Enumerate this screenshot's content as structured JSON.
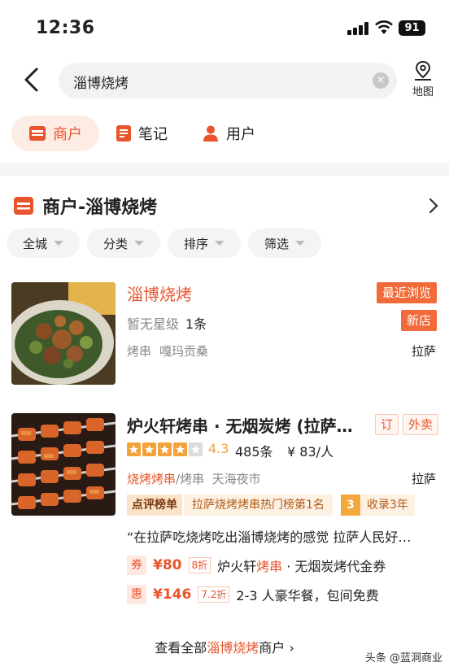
{
  "status_bar": {
    "time": "12:36",
    "battery": "91"
  },
  "header": {
    "search_query": "淄博烧烤",
    "clear_glyph": "×",
    "map_label": "地图"
  },
  "tabs": [
    {
      "label": "商户",
      "icon": "shop-icon",
      "active": true
    },
    {
      "label": "笔记",
      "icon": "note-icon",
      "active": false
    },
    {
      "label": "用户",
      "icon": "user-icon",
      "active": false
    }
  ],
  "section": {
    "title": "商户-淄博烧烤"
  },
  "filters": [
    "全城",
    "分类",
    "排序",
    "筛选"
  ],
  "results": [
    {
      "name": "淄博烧烤",
      "tags": [
        "最近浏览",
        "新店"
      ],
      "rating_text": "暂无星级",
      "count": "1条",
      "categories": [
        "烤串",
        "嘎玛贡桑"
      ],
      "location": "拉萨"
    },
    {
      "name": "炉火轩烤串 · 无烟炭烤 (拉萨…",
      "tags": [
        "订",
        "外卖"
      ],
      "stars": 4,
      "score": "4.3",
      "count": "485条",
      "avg_price": "¥ 83/人",
      "category_highlight": "烧烤烤串",
      "category_rest": "/烤串",
      "area": "天海夜市",
      "location": "拉萨",
      "rank_label": "点评榜单",
      "rank_text": "拉萨烧烤烤串热门榜第1名",
      "rank_years_num": "3",
      "rank_years_text": "收录3年",
      "quote": "“在拉萨吃烧烤吃出淄博烧烤的感觉 拉萨人民好…",
      "deals": [
        {
          "badge": "券",
          "price": "¥80",
          "discount": "8折",
          "desc_prefix": "炉火轩",
          "desc_hl": "烤串",
          "desc_suffix": " · 无烟炭烤代金券"
        },
        {
          "badge": "惠",
          "price": "¥146",
          "discount": "7.2折",
          "desc_prefix": "2-3 人豪华餐，包间免费",
          "desc_hl": "",
          "desc_suffix": ""
        }
      ]
    }
  ],
  "footer": {
    "more_prefix": "查看全部",
    "more_hl": "淄博烧烤",
    "more_suffix": "商户 ›",
    "watermark": "头条 @蓝洞商业"
  },
  "colors": {
    "accent": "#e8552c",
    "tag_bg": "#f06a3a",
    "star": "#f3a33b"
  }
}
